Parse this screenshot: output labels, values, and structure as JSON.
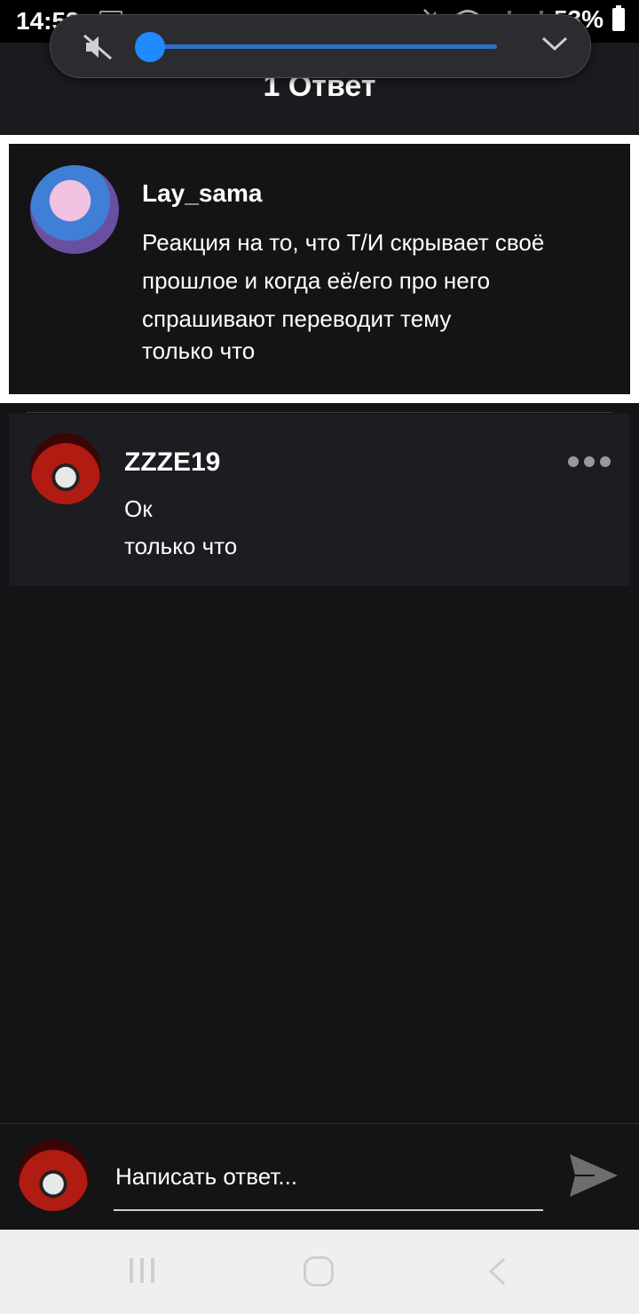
{
  "status_bar": {
    "time": "14:53",
    "battery": "53%"
  },
  "header": {
    "title": "1 Ответ"
  },
  "post": {
    "author": "Lay_sama",
    "text": "Реакция на то, что Т/И скрывает своё прошлое и когда её/его про него спрашивают переводит тему",
    "time": "только что"
  },
  "replies": [
    {
      "author": "ZZZE19",
      "text": "Ок",
      "time": "только что"
    }
  ],
  "compose": {
    "placeholder": "Написать ответ..."
  },
  "volume": {
    "level": 0
  },
  "colors": {
    "accent": "#1f8bff",
    "background": "#141316",
    "card": "#1d1c20"
  }
}
